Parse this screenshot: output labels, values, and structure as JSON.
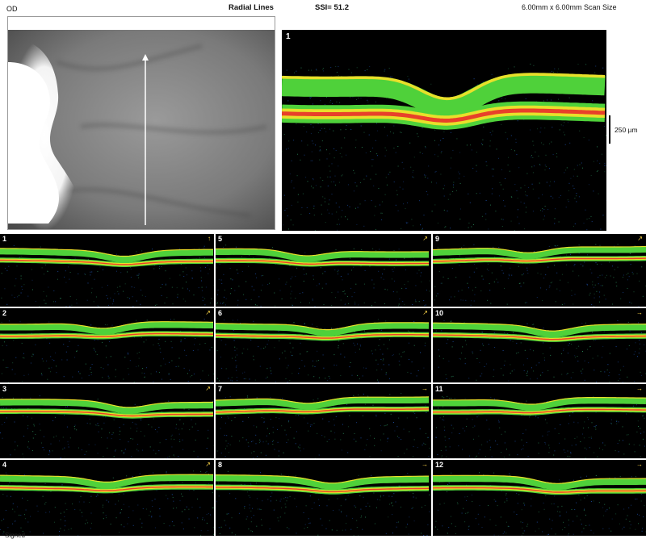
{
  "header": {
    "eye": "OD",
    "scan_pattern": "Radial Lines",
    "ssi": "SSI= 51.2",
    "scan_size": "6.00mm x 6.00mm Scan Size"
  },
  "main_scan": {
    "label": "1"
  },
  "scale_bar": {
    "label": "250 µm"
  },
  "thumbnails": [
    {
      "label": "1"
    },
    {
      "label": "5"
    },
    {
      "label": "9"
    },
    {
      "label": "2"
    },
    {
      "label": "6"
    },
    {
      "label": "10"
    },
    {
      "label": "3"
    },
    {
      "label": "7"
    },
    {
      "label": "11"
    },
    {
      "label": "4"
    },
    {
      "label": "8"
    },
    {
      "label": "12"
    }
  ],
  "footer": {
    "label": "Signed"
  },
  "colors": {
    "layer_green": "#4fd13a",
    "layer_yellow": "#e8e02a",
    "layer_red": "#e8402a",
    "background": "#000000"
  },
  "icons": {
    "scan_arrow": "arrow-icon"
  }
}
